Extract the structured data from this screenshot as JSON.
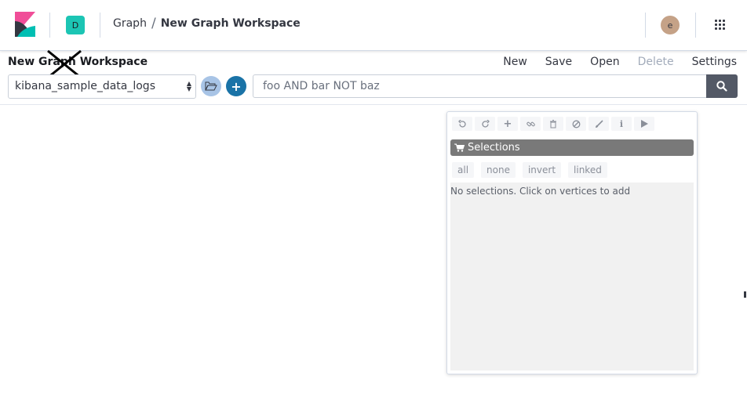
{
  "header": {
    "space_initial": "D",
    "breadcrumbs": [
      {
        "label": "Graph"
      },
      {
        "label": "New Graph Workspace"
      }
    ],
    "breadcrumb_separator": "/",
    "user_initial": "e"
  },
  "workspace": {
    "title": "New Graph Workspace",
    "menu": {
      "new": "New",
      "save": "Save",
      "open": "Open",
      "delete": "Delete",
      "settings": "Settings"
    },
    "index_pattern": "kibana_sample_data_logs",
    "search_placeholder": "foo AND bar NOT baz"
  },
  "panel": {
    "toolbar_icons": [
      "undo-icon",
      "redo-icon",
      "expand-icon",
      "link-icon",
      "trash-icon",
      "blocked-icon",
      "paint-brush-icon",
      "info-icon",
      "play-icon"
    ],
    "selections_title": "Selections",
    "selection_buttons": {
      "all": "all",
      "none": "none",
      "invert": "invert",
      "linked": "linked"
    },
    "empty_message": "No selections. Click on vertices to add"
  },
  "colors": {
    "logo_pink": "#f04e98",
    "logo_teal": "#00bfb3",
    "logo_dark": "#343741",
    "space_avatar": "#1cc5b4",
    "user_avatar": "#c5a287",
    "primary": "#1a73a7",
    "selections_header": "#797979"
  }
}
